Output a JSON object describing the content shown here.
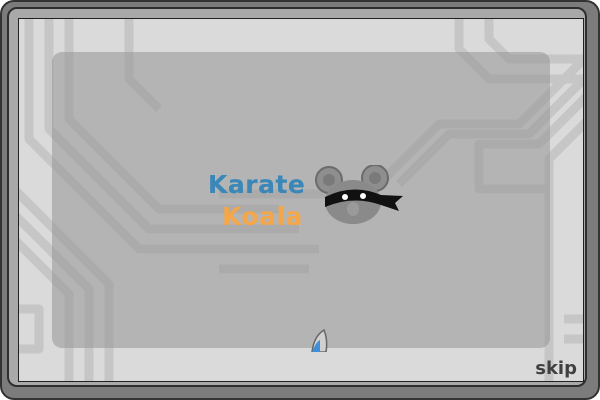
{
  "game": {
    "title_line1": "Karate",
    "title_line2": "Koala",
    "skip_label": "skip"
  },
  "colors": {
    "title_line1": "#3b87b8",
    "title_line2": "#f4a64a",
    "frame": "#7c7c7c",
    "screen_bg": "#dadada",
    "panel": "#969696"
  },
  "icons": {
    "mascot": "ninja-koala-icon",
    "character": "blue-fin-character-icon"
  }
}
